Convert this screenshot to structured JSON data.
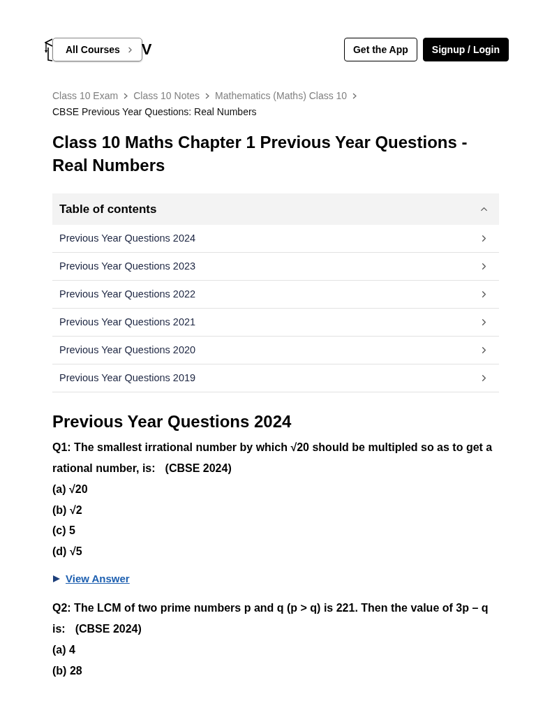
{
  "header": {
    "logo_text": "V",
    "all_courses": {
      "label": "All Courses"
    },
    "buttons": [
      {
        "label": "Get the App",
        "kind": "outline"
      },
      {
        "label": "Signup / Login",
        "kind": "solid"
      }
    ]
  },
  "breadcrumbs": [
    {
      "label": "Class 10 Exam",
      "current": false
    },
    {
      "label": "Class 10 Notes",
      "current": false
    },
    {
      "label": "Mathematics (Maths) Class 10",
      "current": false
    },
    {
      "label": "CBSE Previous Year Questions: Real Numbers",
      "current": true
    }
  ],
  "title": "Class 10 Maths Chapter 1 Previous Year Questions - Real Numbers",
  "toc": {
    "title": "Table of contents",
    "expanded": true,
    "items": [
      "Previous Year Questions 2024",
      "Previous Year Questions 2023",
      "Previous Year Questions 2022",
      "Previous Year Questions 2021",
      "Previous Year Questions 2020",
      "Previous Year Questions 2019"
    ]
  },
  "section": {
    "heading": "Previous Year Questions 2024",
    "questions": [
      {
        "text": "Q1: The smallest irrational number by which √20 should be multipled so as to get a rational number, is:",
        "source": "(CBSE 2024)",
        "options": [
          "(a) √20",
          "(b) √2",
          "(c) 5",
          "(d) √5"
        ],
        "answer": {
          "label": "View Answer",
          "expanded": false
        }
      },
      {
        "text": "Q2: The LCM of two prime numbers p and q (p > q) is 221. Then the value of 3p – q is:",
        "source": "(CBSE 2024)",
        "options": [
          "(a) 4",
          "(b) 28"
        ]
      }
    ]
  }
}
